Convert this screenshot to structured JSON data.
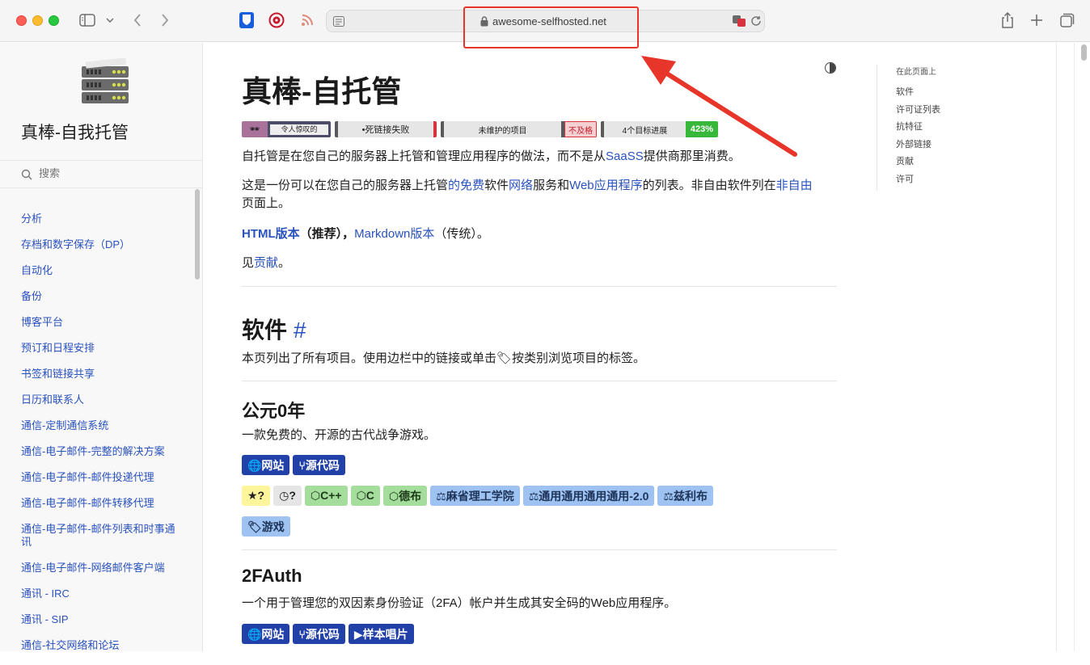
{
  "browser": {
    "url": "awesome-selfhosted.net",
    "icons": {
      "sidebar": "sidebar-icon",
      "chevron": "chevron-down-icon",
      "back": "back-arrow-icon",
      "forward": "forward-arrow-icon",
      "bitwarden": "bitwarden-icon",
      "extension": "extension-icon",
      "rss": "rss-icon",
      "reader": "reader-mode-icon",
      "lock": "lock-icon",
      "translate": "translate-icon",
      "reload": "reload-icon",
      "share": "share-icon",
      "newtab": "new-tab-icon",
      "tabs": "tab-overview-icon"
    }
  },
  "sidebar": {
    "title": "真棒-自我托管",
    "search_placeholder": "搜索",
    "items": [
      "分析",
      "存档和数字保存（DP）",
      "自动化",
      "备份",
      "博客平台",
      "预订和日程安排",
      "书签和链接共享",
      "日历和联系人",
      "通信-定制通信系统",
      "通信-电子邮件-完整的解决方案",
      "通信-电子邮件-邮件投递代理",
      "通信-电子邮件-邮件转移代理",
      "通信-电子邮件-邮件列表和时事通讯",
      "通信-电子邮件-网络邮件客户端",
      "通讯 - IRC",
      "通讯 - SIP",
      "通信-社交网络和论坛"
    ]
  },
  "main": {
    "title": "真棒-自托管",
    "badges": [
      {
        "left": "🕶",
        "right": "令人惊叹的"
      },
      {
        "left": "",
        "right": "•死链接失败"
      },
      {
        "left": "",
        "right": "未维护的项目",
        "extra": "不及格"
      },
      {
        "left": "",
        "right": "4个目标进展",
        "extra": "423%"
      }
    ],
    "intro": {
      "p1_a": "自托管是在您自己的服务器上托管和管理应用程序的做法，而不是从",
      "p1_link": "SaaSS",
      "p1_b": "提供商那里消费。",
      "p2_a": "这是一份可以在您自己的服务器上托管",
      "p2_link1": "的免费",
      "p2_b": "软件",
      "p2_link2": "网络",
      "p2_c": "服务和",
      "p2_link3": "Web应用程序",
      "p2_d": "的列表。非自由软件列在",
      "p2_link4": "非自由",
      "p2_e": "页面上。",
      "p3_link1": "HTML版本",
      "p3_b": "（推荐），",
      "p3_link2": "Markdown版本",
      "p3_c": "（传统）。",
      "p4_a": "见",
      "p4_link": "贡献",
      "p4_b": "。"
    },
    "software_heading": "软件",
    "anchor": "#",
    "software_desc": "本页列出了所有项目。使用边栏中的链接或单击🏷按类别浏览项目的标签。",
    "projects": [
      {
        "name": "公元0年",
        "desc": "一款免费的、开源的古代战争游戏。",
        "links": [
          "🌐网站",
          "⑂源代码"
        ],
        "tags": [
          {
            "text": "★?",
            "style": "yellow"
          },
          {
            "text": "◷?",
            "style": "grey"
          },
          {
            "text": "⬡C++",
            "style": "green"
          },
          {
            "text": "⬡C",
            "style": "green"
          },
          {
            "text": "⬡德布",
            "style": "green"
          },
          {
            "text": "⚖麻省理工学院",
            "style": "blue"
          },
          {
            "text": "⚖通用通用通用通用-2.0",
            "style": "blue"
          },
          {
            "text": "⚖兹利布",
            "style": "blue"
          }
        ],
        "categories": [
          "🏷游戏"
        ]
      },
      {
        "name": "2FAuth",
        "desc": "一个用于管理您的双因素身份验证（2FA）帐户并生成其安全码的Web应用程序。",
        "links": [
          "🌐网站",
          "⑂源代码",
          "▶样本唱片"
        ]
      }
    ]
  },
  "toc": {
    "title": "在此页面上",
    "items": [
      "软件",
      "许可证列表",
      "抗特征",
      "外部链接",
      "贡献",
      "许可"
    ]
  },
  "colors": {
    "link": "#2a52be",
    "tag_dark": "#2140a8",
    "annotation_red": "#e8352a"
  }
}
